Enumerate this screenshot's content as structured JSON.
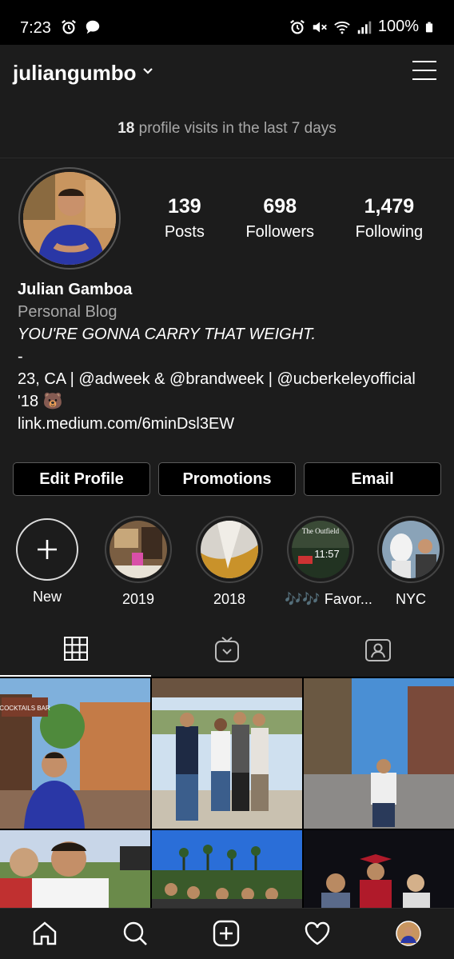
{
  "status_bar": {
    "time": "7:23",
    "battery": "100%",
    "icons": [
      "alarm-icon",
      "chat-icon",
      "alarm-icon",
      "mute-icon",
      "wifi-icon",
      "signal-icon",
      "battery-icon"
    ]
  },
  "header": {
    "username": "juliangumbo",
    "icons": [
      "chevron-down-icon",
      "menu-icon"
    ]
  },
  "insights": {
    "count": "18",
    "text": " profile visits in the last 7 days"
  },
  "profile": {
    "stats": [
      {
        "value": "139",
        "label": "Posts"
      },
      {
        "value": "698",
        "label": "Followers"
      },
      {
        "value": "1,479",
        "label": "Following"
      }
    ],
    "name": "Julian Gamboa",
    "category": "Personal Blog",
    "bio_lines": [
      "YOU'RE GONNA CARRY THAT WEIGHT.",
      "-",
      "23, CA | @adweek & @brandweek | @ucberkeleyofficial",
      "'18 🐻",
      "link.medium.com/6minDsl3EW"
    ]
  },
  "buttons": {
    "edit_profile": "Edit Profile",
    "promotions": "Promotions",
    "email": "Email"
  },
  "highlights": [
    {
      "label": "New"
    },
    {
      "label": "2019"
    },
    {
      "label": "2018"
    },
    {
      "label": "🎶🎶 Favor..."
    },
    {
      "label": "NYC"
    }
  ],
  "highlight_thumbnail_text": {
    "line1": "The Outfield",
    "line2": "11:57"
  },
  "grid_photo_text": {
    "sign": "COCKTAILS BAR"
  },
  "tabs": [
    "grid-icon",
    "igtv-icon",
    "tagged-icon"
  ],
  "bottom_nav": [
    "home-icon",
    "search-icon",
    "add-icon",
    "heart-icon",
    "profile-avatar"
  ],
  "colors": {
    "background": "#000000",
    "surface": "#1c1c1c",
    "secondary_text": "#a8a8a8",
    "border": "#5a5a5a"
  }
}
